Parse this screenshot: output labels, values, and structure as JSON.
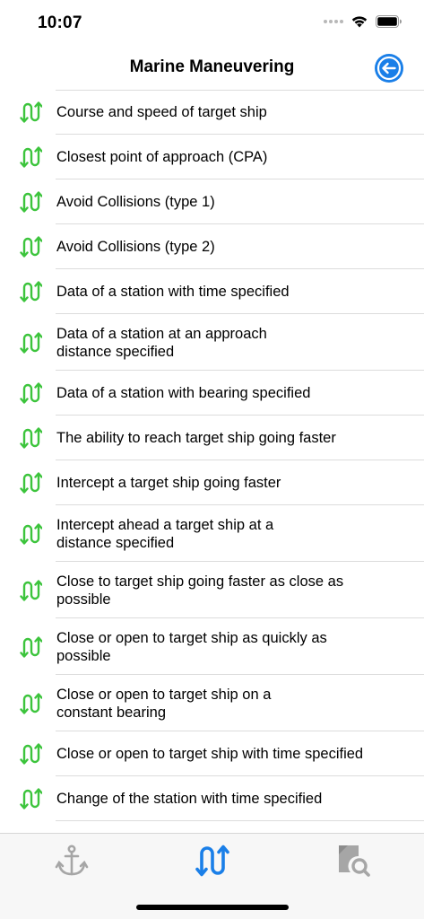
{
  "status_bar": {
    "time": "10:07",
    "signal_icon": "signal-dots-icon",
    "wifi_icon": "wifi-icon",
    "battery_icon": "battery-icon"
  },
  "nav": {
    "title": "Marine Maneuvering",
    "back_icon": "arrow-left-circle-icon",
    "accent_color": "#1a7fe8"
  },
  "list": {
    "row_icon": "up-down-arrows-icon",
    "icon_color": "#3cc43c",
    "items": [
      "Course and speed of target ship",
      "Closest point of approach (CPA)",
      "Avoid Collisions (type 1)",
      "Avoid Collisions (type 2)",
      "Data of a station with time specified",
      "Data of a station at an approach distance specified",
      "Data of a station with bearing specified",
      "The ability to reach target ship going faster",
      "Intercept a target ship going faster",
      "Intercept ahead a target ship at a distance specified",
      "Close to target ship going faster as close as possible",
      "Close or open to target ship as quickly as possible",
      "Close or open to target ship on a constant bearing",
      "Close or open to target ship with time specified",
      "Change of the station with time specified"
    ]
  },
  "tab_bar": {
    "tabs": [
      {
        "icon": "anchor-icon",
        "selected": false
      },
      {
        "icon": "up-down-arrows-icon",
        "selected": true
      },
      {
        "icon": "document-search-icon",
        "selected": false
      }
    ],
    "selected_color": "#1a7fe8",
    "unselected_color": "#a6a6a6"
  }
}
